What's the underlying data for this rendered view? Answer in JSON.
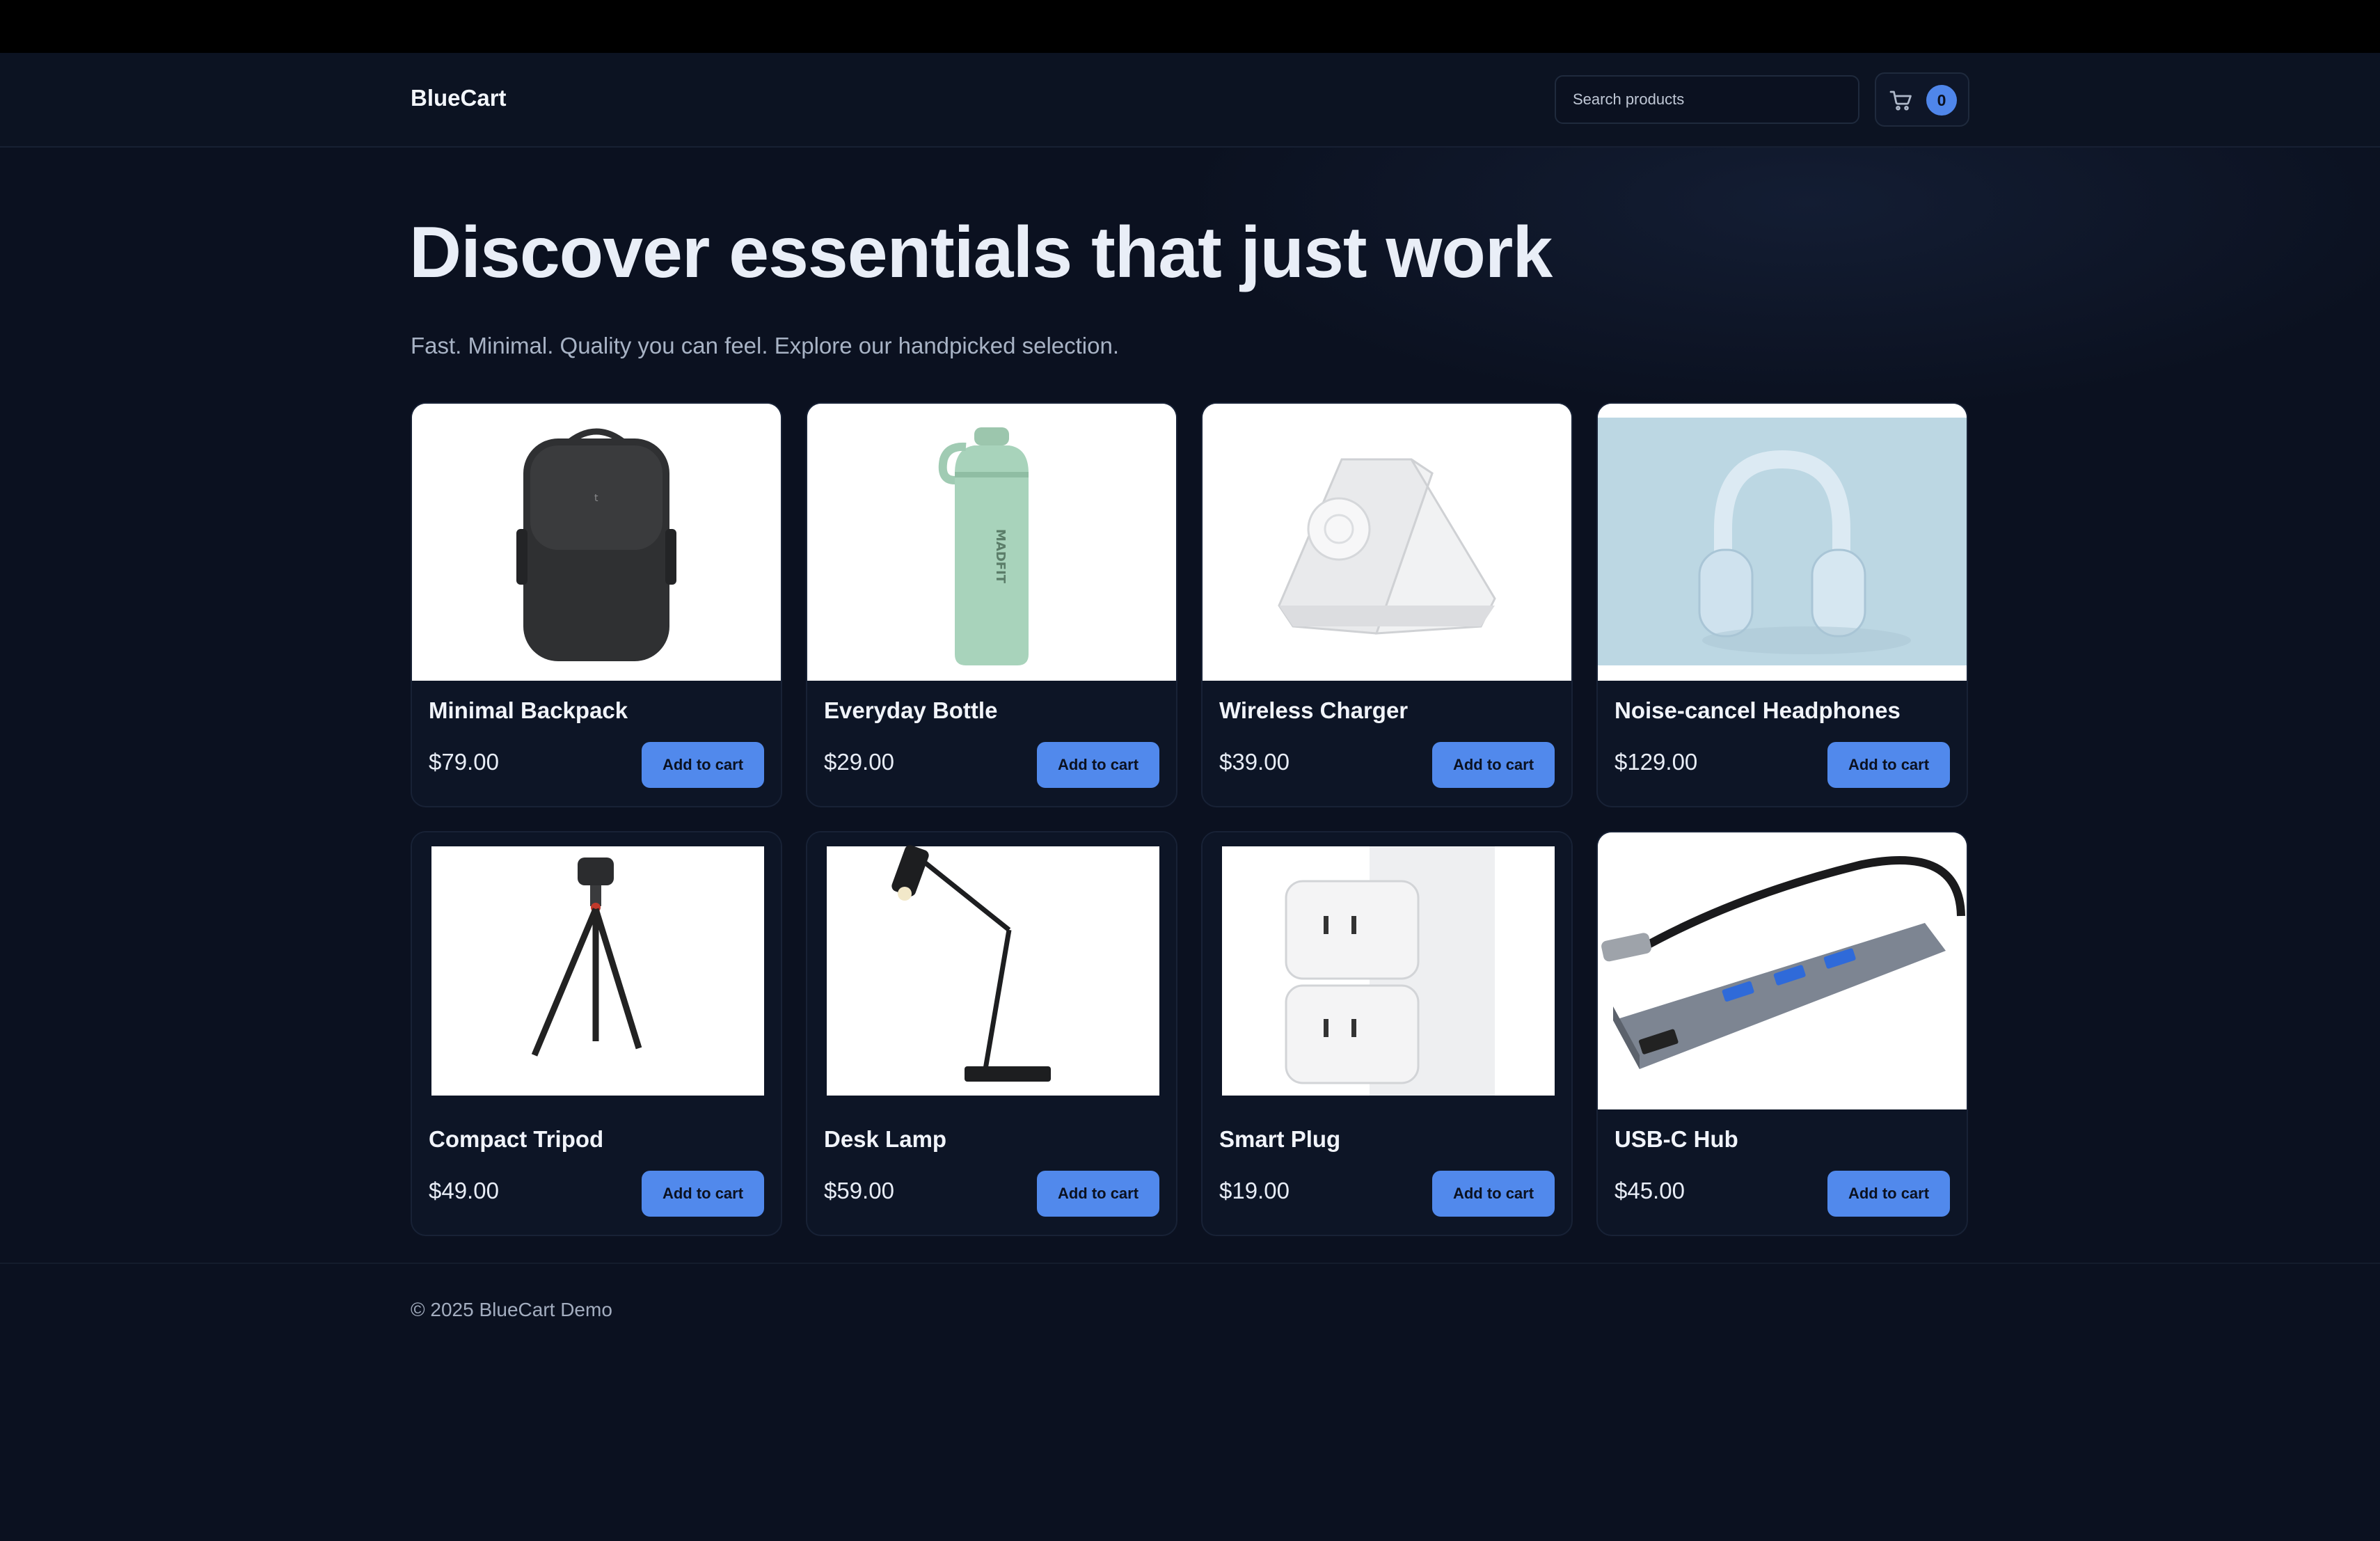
{
  "header": {
    "brand": "BlueCart",
    "search_placeholder": "Search products",
    "cart_count": "0"
  },
  "hero": {
    "title": "Discover essentials that just work",
    "subtitle": "Fast. Minimal. Quality you can feel. Explore our handpicked selection."
  },
  "products": [
    {
      "name": "Minimal Backpack",
      "price": "$79.00",
      "button": "Add to cart",
      "icon": "backpack-image"
    },
    {
      "name": "Everyday Bottle",
      "price": "$29.00",
      "button": "Add to cart",
      "icon": "bottle-image"
    },
    {
      "name": "Wireless Charger",
      "price": "$39.00",
      "button": "Add to cart",
      "icon": "charger-image"
    },
    {
      "name": "Noise-cancel Headphones",
      "price": "$129.00",
      "button": "Add to cart",
      "icon": "headphones-image"
    },
    {
      "name": "Compact Tripod",
      "price": "$49.00",
      "button": "Add to cart",
      "icon": "tripod-image"
    },
    {
      "name": "Desk Lamp",
      "price": "$59.00",
      "button": "Add to cart",
      "icon": "lamp-image"
    },
    {
      "name": "Smart Plug",
      "price": "$19.00",
      "button": "Add to cart",
      "icon": "plug-image"
    },
    {
      "name": "USB-C Hub",
      "price": "$45.00",
      "button": "Add to cart",
      "icon": "hub-image"
    }
  ],
  "footer": {
    "text": "© 2025 BlueCart Demo"
  },
  "colors": {
    "background": "#0b1120",
    "accent": "#5189ec",
    "card": "#0d1526"
  }
}
